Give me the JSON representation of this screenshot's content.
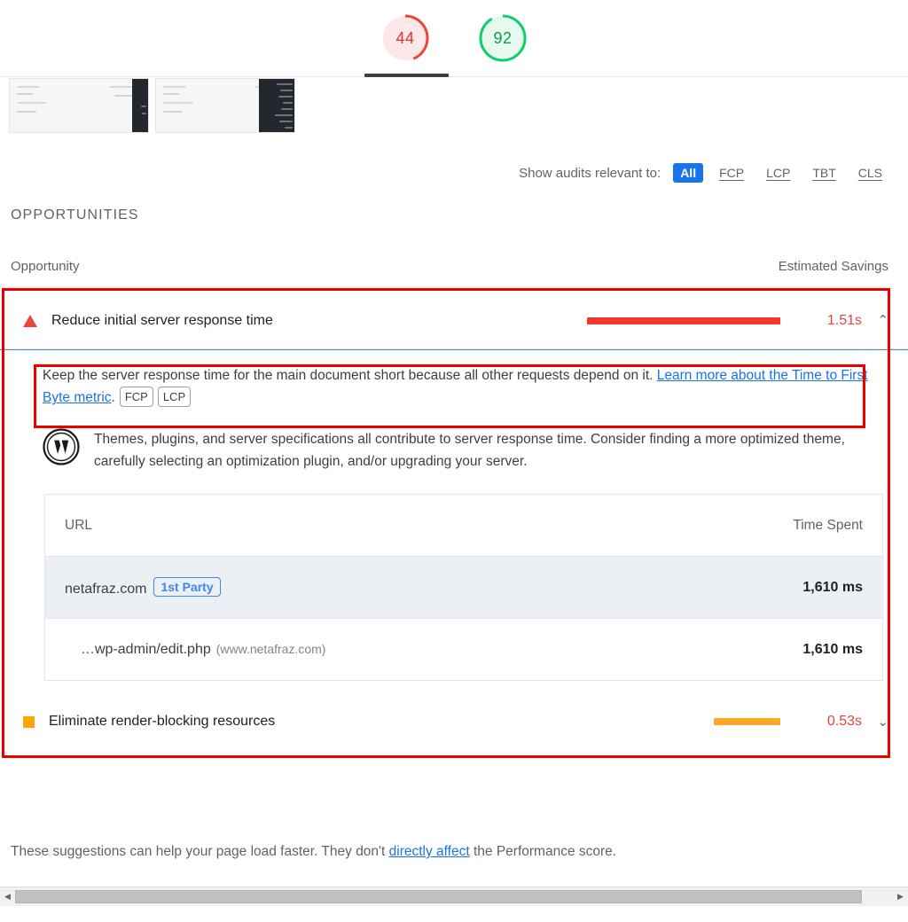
{
  "scores": [
    {
      "name": "performance-score",
      "value": "44",
      "color": "#e33030",
      "track": "#fce8e8",
      "percent": 44,
      "active": true
    },
    {
      "name": "accessibility-score",
      "value": "92",
      "color": "#0c9c4c",
      "track": "#e7f8ee",
      "percent": 92,
      "active": false
    }
  ],
  "filter": {
    "label": "Show audits relevant to:",
    "chips": [
      {
        "label": "All",
        "active": true
      },
      {
        "label": "FCP",
        "active": false
      },
      {
        "label": "LCP",
        "active": false
      },
      {
        "label": "TBT",
        "active": false
      },
      {
        "label": "CLS",
        "active": false
      }
    ],
    "active_color": "#1a73e8"
  },
  "section": {
    "title": "OPPORTUNITIES",
    "col_opportunity": "Opportunity",
    "col_savings": "Estimated Savings"
  },
  "opportunities": [
    {
      "title": "Reduce initial server response time",
      "savings": "1.51s",
      "severity": "error",
      "severity_color": "#e8453c",
      "expanded": true,
      "chevron": "⌃",
      "description_part1": "Keep the server response time for the main document short because all other requests depend on it. ",
      "description_link": "Learn more about the Time to First Byte metric",
      "description_part2": ".",
      "metric_pills": [
        "FCP",
        "LCP"
      ],
      "stackpack": {
        "icon": "wordpress-icon",
        "text": "Themes, plugins, and server specifications all contribute to server response time. Consider finding a more optimized theme, carefully selecting an optimization plugin, and/or upgrading your server."
      },
      "table": {
        "columns": [
          "URL",
          "Time Spent"
        ],
        "rows": [
          {
            "url": "netafraz.com",
            "badge": "1st Party",
            "host": "",
            "time": "1,610 ms",
            "alt": true,
            "indent": false
          },
          {
            "url": "…wp-admin/edit.php",
            "badge": "",
            "host": "(www.netafraz.com)",
            "time": "1,610 ms",
            "alt": false,
            "indent": true
          }
        ]
      }
    },
    {
      "title": "Eliminate render-blocking resources",
      "savings": "0.53s",
      "severity": "warning",
      "severity_color": "#ffa400",
      "expanded": false,
      "chevron": "⌄"
    }
  ],
  "footnote": {
    "part1": "These suggestions can help your page load faster. They don't ",
    "link": "directly affect",
    "part2": " the Performance score."
  },
  "scrollbar": {
    "left_arrow": "◀",
    "right_arrow": "▶"
  }
}
